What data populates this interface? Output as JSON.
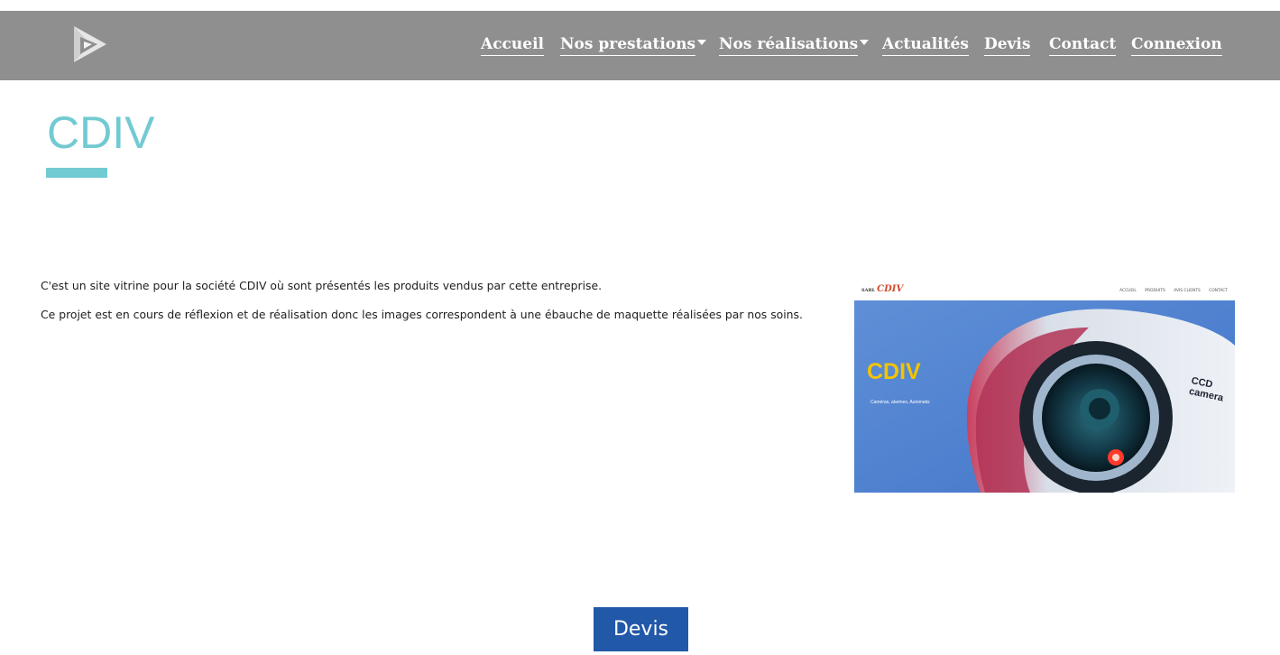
{
  "header": {
    "logo_icon": "triangle-logo-icon",
    "background_color": "#8f8f8f",
    "nav": [
      {
        "label": "Accueil",
        "dropdown": false
      },
      {
        "label": "Nos prestations",
        "dropdown": true
      },
      {
        "label": "Nos réalisations",
        "dropdown": true
      },
      {
        "label": "Actualités",
        "dropdown": false
      },
      {
        "label": "Devis",
        "dropdown": false
      },
      {
        "label": "Contact",
        "dropdown": false
      },
      {
        "label": "Connexion",
        "dropdown": false
      }
    ]
  },
  "main": {
    "title": "CDIV",
    "accent_color": "#72cad2",
    "paragraphs": [
      "C'est un site vitrine pour la société CDIV où sont présentés les produits vendus par cette entreprise.",
      "Ce projet est en cours de réflexion et de réalisation donc les images correspondent à une ébauche de maquette réalisées par nos soins."
    ],
    "mockup": {
      "brand_prefix": "SARL",
      "brand": "CDIV",
      "menu": [
        "ACCUEIL",
        "PRODUITS",
        "AVIS CLIENTS",
        "CONTACT"
      ],
      "hero_title": "CDIV",
      "hero_subtitle": "Caméras, alarmes, Automatis",
      "camera_label": "CCD camera"
    }
  },
  "footer": {
    "devis_button": "Devis",
    "button_color": "#2258a8"
  }
}
